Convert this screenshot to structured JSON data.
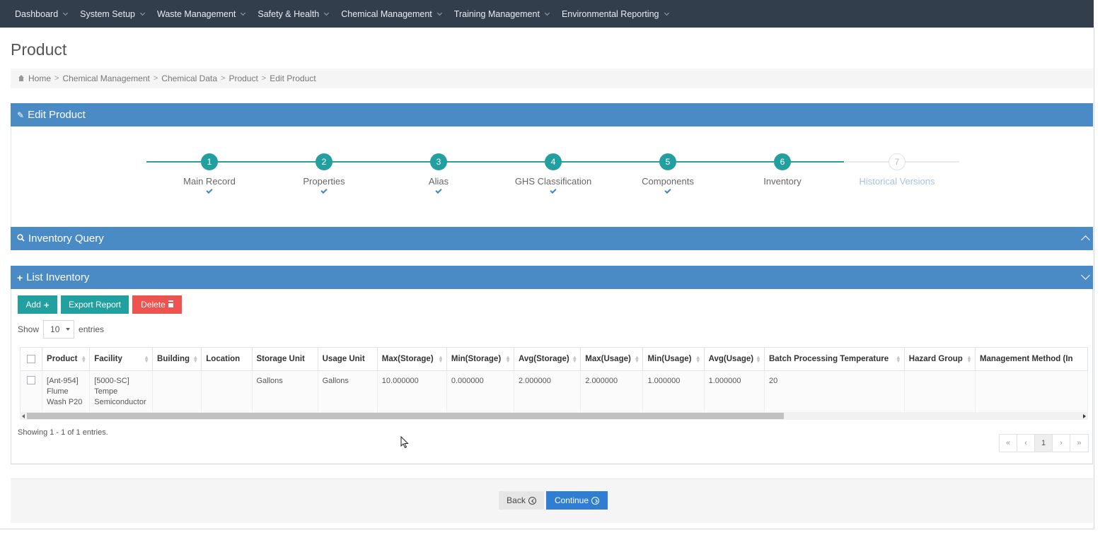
{
  "nav": {
    "items": [
      {
        "label": "Dashboard"
      },
      {
        "label": "System Setup"
      },
      {
        "label": "Waste Management"
      },
      {
        "label": "Safety & Health"
      },
      {
        "label": "Chemical Management"
      },
      {
        "label": "Training Management"
      },
      {
        "label": "Environmental Reporting"
      }
    ]
  },
  "page": {
    "title": "Product"
  },
  "breadcrumb": [
    "Home",
    "Chemical Management",
    "Chemical Data",
    "Product",
    "Edit Product"
  ],
  "edit_panel": {
    "title": "Edit Product",
    "icon": "pencil-icon"
  },
  "wizard": {
    "steps": [
      {
        "number": "1",
        "label": "Main Record",
        "status": "done"
      },
      {
        "number": "2",
        "label": "Properties",
        "status": "done"
      },
      {
        "number": "3",
        "label": "Alias",
        "status": "done"
      },
      {
        "number": "4",
        "label": "GHS Classification",
        "status": "done"
      },
      {
        "number": "5",
        "label": "Components",
        "status": "done"
      },
      {
        "number": "6",
        "label": "Inventory",
        "status": "current"
      },
      {
        "number": "7",
        "label": "Historical Versions",
        "status": "pending"
      }
    ]
  },
  "query_panel": {
    "title": "Inventory Query",
    "icon": "search-icon"
  },
  "list_panel": {
    "title": "List Inventory",
    "icon": "plus-icon"
  },
  "toolbar": {
    "add_label": "Add",
    "export_label": "Export Report",
    "delete_label": "Delete"
  },
  "entries": {
    "show_label": "Show",
    "selected": "10",
    "suffix": "entries"
  },
  "table": {
    "headers": [
      "Product",
      "Facility",
      "Building",
      "Location",
      "Storage Unit",
      "Usage Unit",
      "Max(Storage)",
      "Min(Storage)",
      "Avg(Storage)",
      "Max(Usage)",
      "Min(Usage)",
      "Avg(Usage)",
      "Batch Processing Temperature",
      "Hazard Group",
      "Management Method (In"
    ],
    "rows": [
      {
        "product": "[Ant-954] Flume Wash P20",
        "facility": "[5000-SC] Tempe Semiconductor",
        "building": "",
        "location": "",
        "storage_unit": "Gallons",
        "usage_unit": "Gallons",
        "max_storage": "10.000000",
        "min_storage": "0.000000",
        "avg_storage": "2.000000",
        "max_usage": "2.000000",
        "min_usage": "1.000000",
        "avg_usage": "1.000000",
        "batch_temp": "20",
        "hazard_group": "",
        "management_method": ""
      }
    ]
  },
  "showing_text": "Showing 1 - 1 of 1 entries.",
  "pagination": {
    "first": "«",
    "prev": "‹",
    "current": "1",
    "next": "›",
    "last": "»"
  },
  "footer": {
    "back_label": "Back",
    "continue_label": "Continue"
  },
  "colors": {
    "nav_bg": "#333e4d",
    "panel_blue": "#4b8bc5",
    "teal": "#22a0a0",
    "danger": "#ef5350",
    "primary": "#2f7ed2"
  }
}
